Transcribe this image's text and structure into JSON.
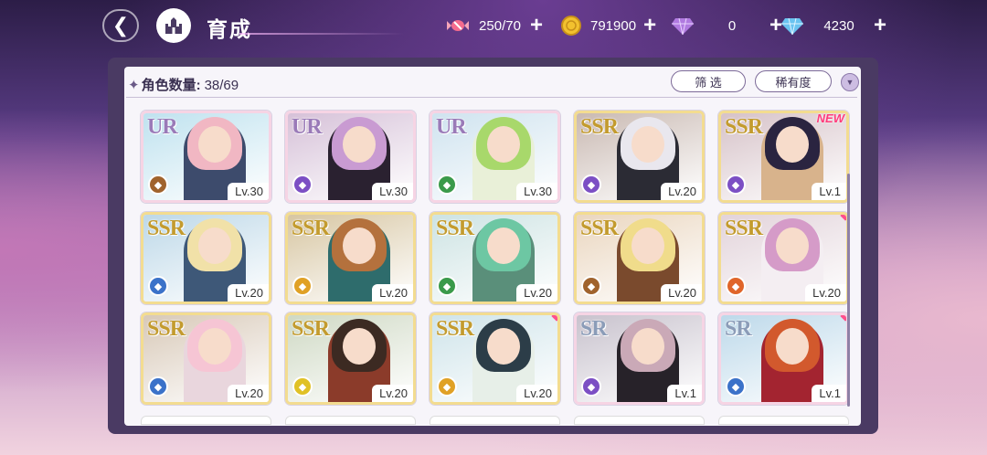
{
  "header": {
    "title": "育成",
    "resources": [
      {
        "icon": "candy-icon",
        "value": "250/70"
      },
      {
        "icon": "gold-coin-icon",
        "value": "791900"
      },
      {
        "icon": "purple-gem-icon",
        "value": "0"
      },
      {
        "icon": "blue-diamond-icon",
        "value": "4230"
      }
    ],
    "plus_label": "+"
  },
  "toolbar": {
    "count_label": "角色数量:",
    "count_value": "38/69",
    "filter_label": "筛 选",
    "rarity_label": "稀有度",
    "sort_toggle_label": "▼"
  },
  "cards": [
    {
      "rarity": "UR",
      "level": "Lv.30",
      "attr_color": "#a0632d",
      "new": false,
      "dot": false,
      "hair": "#f1b7c3",
      "outfit": "#3d4b6c",
      "bg": "#bfe2ef",
      "frame": "rose"
    },
    {
      "rarity": "UR",
      "level": "Lv.30",
      "attr_color": "#7c4fc4",
      "new": false,
      "dot": false,
      "hair": "#c99bd2",
      "outfit": "#2a2130",
      "bg": "#d6c1d8",
      "frame": "rose"
    },
    {
      "rarity": "UR",
      "level": "Lv.30",
      "attr_color": "#3a9a4a",
      "new": false,
      "dot": false,
      "hair": "#a8d86b",
      "outfit": "#e9f0d8",
      "bg": "#cfe3ef",
      "frame": "rose"
    },
    {
      "rarity": "SSR",
      "level": "Lv.20",
      "attr_color": "#7c4fc4",
      "new": false,
      "dot": false,
      "hair": "#e9e7ee",
      "outfit": "#2b2b34",
      "bg": "#c9b9b2",
      "frame": "gold"
    },
    {
      "rarity": "SSR",
      "level": "Lv.1",
      "attr_color": "#7c4fc4",
      "new": true,
      "dot": false,
      "hair": "#2a2440",
      "outfit": "#d8b38c",
      "bg": "#d6c2c8",
      "frame": "gold"
    },
    {
      "rarity": "SSR",
      "level": "Lv.20",
      "attr_color": "#3b72c9",
      "new": false,
      "dot": false,
      "hair": "#f1e1a8",
      "outfit": "#3e5878",
      "bg": "#bdd8e8",
      "frame": "gold"
    },
    {
      "rarity": "SSR",
      "level": "Lv.20",
      "attr_color": "#e0a125",
      "new": false,
      "dot": false,
      "hair": "#b4713d",
      "outfit": "#2e6c6c",
      "bg": "#d7c6a2",
      "frame": "gold"
    },
    {
      "rarity": "SSR",
      "level": "Lv.20",
      "attr_color": "#3a9a4a",
      "new": false,
      "dot": false,
      "hair": "#6dc7a3",
      "outfit": "#5a8f7a",
      "bg": "#cde3e3",
      "frame": "gold"
    },
    {
      "rarity": "SSR",
      "level": "Lv.20",
      "attr_color": "#a0632d",
      "new": false,
      "dot": false,
      "hair": "#f0dc8b",
      "outfit": "#7a4a2d",
      "bg": "#ead6bf",
      "frame": "gold"
    },
    {
      "rarity": "SSR",
      "level": "Lv.20",
      "attr_color": "#e0652a",
      "new": false,
      "dot": true,
      "hair": "#d59bc8",
      "outfit": "#f4eef2",
      "bg": "#e2d3da",
      "frame": "gold"
    },
    {
      "rarity": "SSR",
      "level": "Lv.20",
      "attr_color": "#3b72c9",
      "new": false,
      "dot": false,
      "hair": "#f6c5d4",
      "outfit": "#e9d6dd",
      "bg": "#d8c9b8",
      "frame": "gold"
    },
    {
      "rarity": "SSR",
      "level": "Lv.20",
      "attr_color": "#e0c125",
      "new": false,
      "dot": false,
      "hair": "#3c2a22",
      "outfit": "#8b3b2a",
      "bg": "#cfd9c4",
      "frame": "gold"
    },
    {
      "rarity": "SSR",
      "level": "Lv.20",
      "attr_color": "#e0a125",
      "new": false,
      "dot": true,
      "hair": "#2c3d48",
      "outfit": "#e7efe8",
      "bg": "#cfe4ea",
      "frame": "gold"
    },
    {
      "rarity": "SR",
      "level": "Lv.1",
      "attr_color": "#7c4fc4",
      "new": false,
      "dot": false,
      "hair": "#caa9b7",
      "outfit": "#272229",
      "bg": "#c8c2cd",
      "frame": "rose"
    },
    {
      "rarity": "SR",
      "level": "Lv.1",
      "attr_color": "#3b72c9",
      "new": false,
      "dot": true,
      "hair": "#d2592d",
      "outfit": "#a32430",
      "bg": "#bdd9ea",
      "frame": "rose"
    }
  ]
}
